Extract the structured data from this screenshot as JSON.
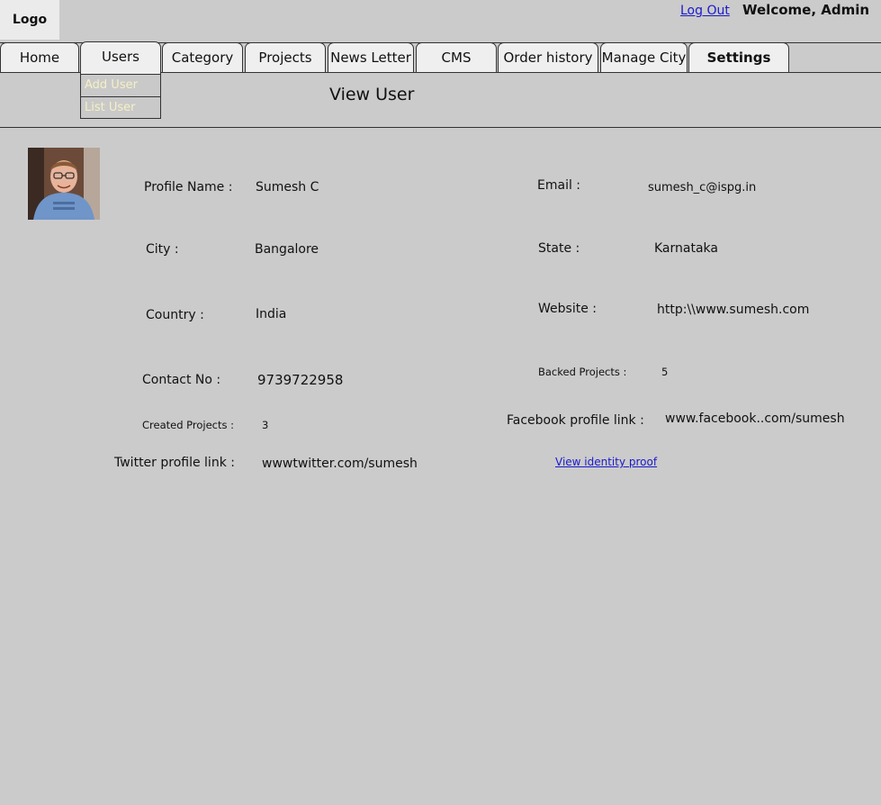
{
  "header": {
    "logo": "Logo",
    "logout": "Log Out",
    "welcome": "Welcome, Admin"
  },
  "nav": {
    "tabs": [
      "Home",
      "Users",
      "Category",
      "Projects",
      "News Letter",
      "CMS",
      "Order history",
      "Manage City",
      "Settings"
    ],
    "users_submenu": [
      "Add User",
      "List User"
    ]
  },
  "page": {
    "title": "View User"
  },
  "profile": {
    "profile_name_label": "Profile Name :",
    "profile_name": "Sumesh C",
    "email_label": "Email :",
    "email": "sumesh_c@ispg.in",
    "city_label": "City :",
    "city": "Bangalore",
    "state_label": "State :",
    "state": "Karnataka",
    "country_label": "Country :",
    "country": "India",
    "website_label": "Website :",
    "website": "http:\\\\www.sumesh.com",
    "contact_label": "Contact No :",
    "contact": "9739722958",
    "backed_label": "Backed Projects :",
    "backed": "5",
    "created_label": "Created Projects :",
    "created": "3",
    "facebook_label": "Facebook profile link :",
    "facebook": "www.facebook..com/sumesh",
    "twitter_label": "Twitter profile link :",
    "twitter": "wwwtwitter.com/sumesh",
    "identity_link": "View identity proof"
  }
}
